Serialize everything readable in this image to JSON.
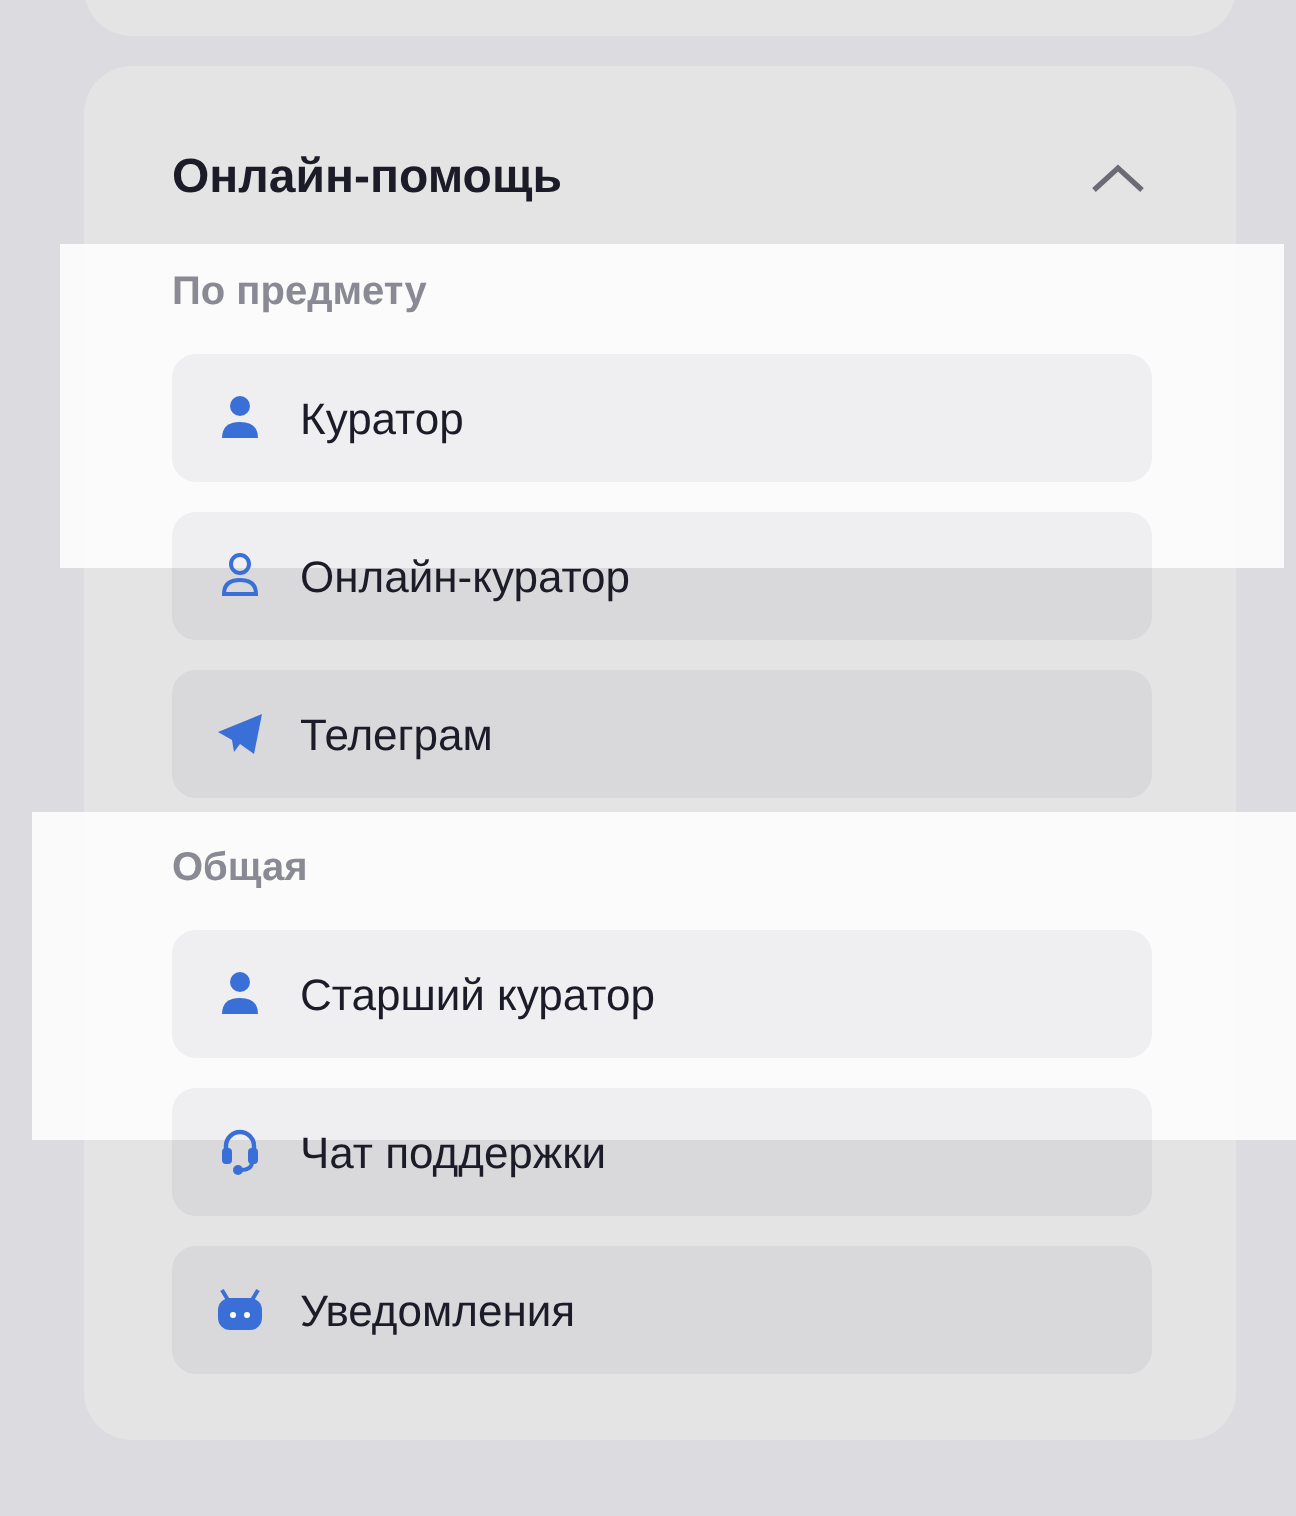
{
  "panel": {
    "title": "Онлайн-помощь",
    "expanded": true,
    "sections": [
      {
        "label": "По предмету",
        "items": [
          {
            "label": "Куратор"
          },
          {
            "label": "Онлайн-куратор"
          },
          {
            "label": "Телеграм"
          }
        ]
      },
      {
        "label": "Общая",
        "items": [
          {
            "label": "Старший куратор"
          },
          {
            "label": "Чат поддержки"
          },
          {
            "label": "Уведомления"
          }
        ]
      }
    ]
  }
}
